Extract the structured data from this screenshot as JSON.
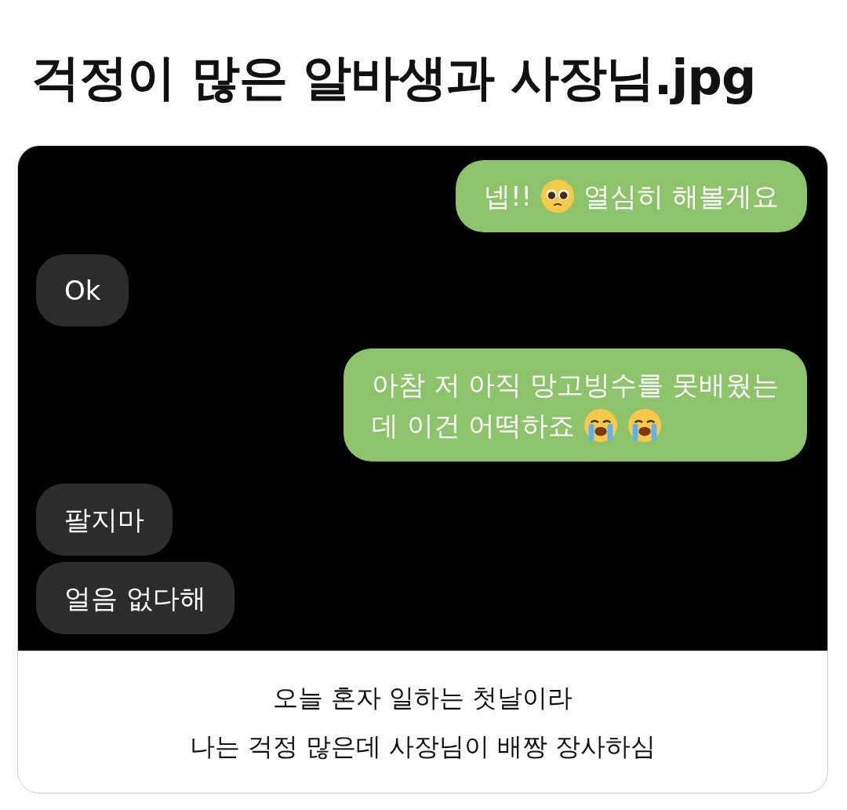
{
  "title": "걱정이 많은 알바생과 사장님.jpg",
  "messages": [
    {
      "sent": true,
      "lines": [
        [
          {
            "kind": "text",
            "text": "넵!!"
          },
          {
            "kind": "pleading"
          },
          {
            "kind": "text",
            "text": "열심히 해볼게요"
          }
        ]
      ]
    },
    {
      "sent": false,
      "lines": [
        [
          {
            "kind": "text",
            "text": "Ok"
          }
        ]
      ]
    },
    {
      "sent": true,
      "lines": [
        [
          {
            "kind": "text",
            "text": "아참 저 아직 망고빙수를 못배웠는"
          }
        ],
        [
          {
            "kind": "text",
            "text": "데 이건 어떡하죠"
          },
          {
            "kind": "crying"
          },
          {
            "kind": "crying"
          }
        ]
      ]
    },
    {
      "sent": false,
      "lines": [
        [
          {
            "kind": "text",
            "text": "팔지마"
          }
        ]
      ]
    },
    {
      "sent": false,
      "lines": [
        [
          {
            "kind": "text",
            "text": "얼음 없다해"
          }
        ]
      ]
    }
  ],
  "caption": [
    "오늘 혼자 일하는 첫날이라",
    "나는 걱정 많은데 사장님이 배짱 장사하심"
  ]
}
